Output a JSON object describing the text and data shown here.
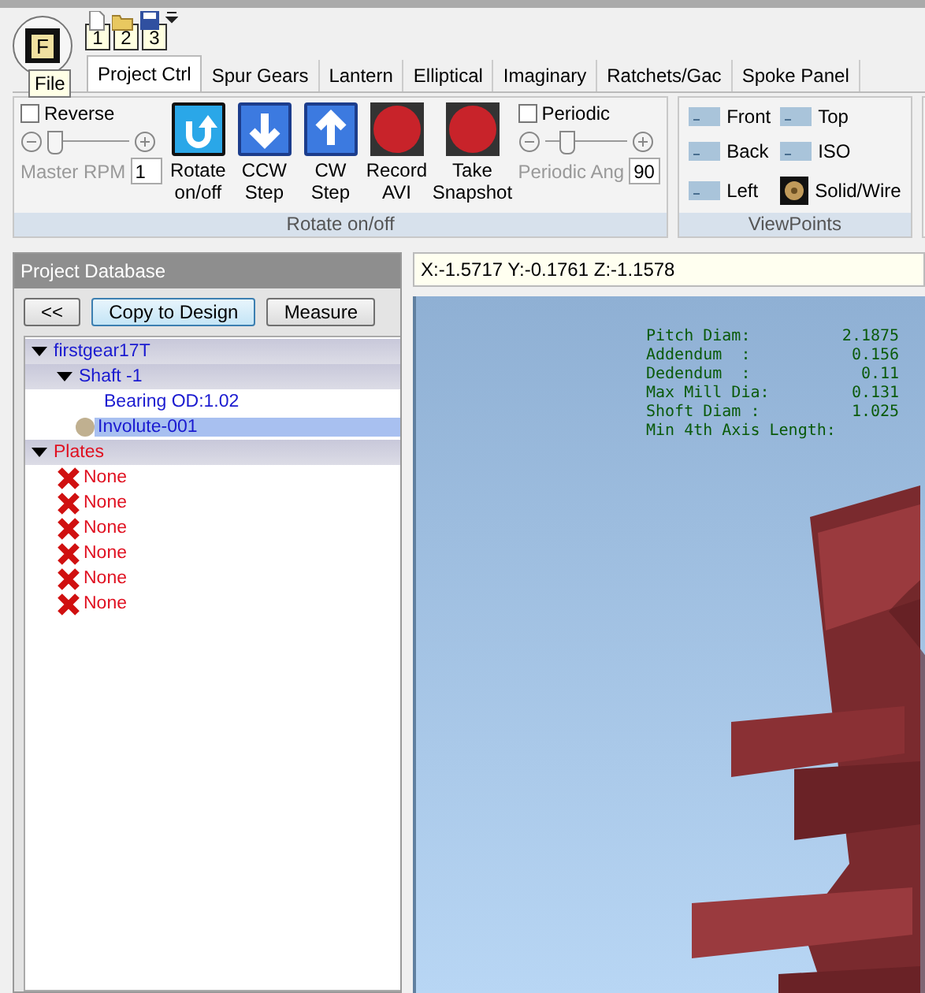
{
  "quick_access": {
    "app_button": "F",
    "tooltip": "File",
    "key_tips": [
      "1",
      "2",
      "3"
    ]
  },
  "tabs": [
    {
      "label": "Project Ctrl",
      "selected": true
    },
    {
      "label": "Spur Gears",
      "selected": false
    },
    {
      "label": "Lantern",
      "selected": false
    },
    {
      "label": "Elliptical",
      "selected": false
    },
    {
      "label": "Imaginary",
      "selected": false
    },
    {
      "label": "Ratchets/Gac",
      "selected": false
    },
    {
      "label": "Spoke Panel",
      "selected": false
    }
  ],
  "rotate_group": {
    "caption": "Rotate on/off",
    "reverse": {
      "label": "Reverse",
      "checked": false
    },
    "master": {
      "label": "Master RPM",
      "value": "1",
      "level": 0.08
    },
    "buttons": [
      {
        "label": "Rotate on/off",
        "kind": "rotate"
      },
      {
        "label": "CCW Step",
        "kind": "down"
      },
      {
        "label": "CW Step",
        "kind": "up"
      },
      {
        "label": "Record AVI",
        "kind": "record"
      },
      {
        "label": "Take Snapshot",
        "kind": "record"
      }
    ],
    "periodic": {
      "label": "Periodic",
      "checked": false
    },
    "periodic_angle": {
      "label": "Periodic Ang",
      "value": "90",
      "level": 0.25
    }
  },
  "viewpoints": {
    "caption": "ViewPoints",
    "items": [
      {
        "label": "Front",
        "kind": "view"
      },
      {
        "label": "Top",
        "kind": "view"
      },
      {
        "label": "Back",
        "kind": "view"
      },
      {
        "label": "ISO",
        "kind": "view"
      },
      {
        "label": "Left",
        "kind": "view"
      },
      {
        "label": "Solid/Wire",
        "kind": "solid"
      }
    ]
  },
  "database": {
    "title": "Project Database",
    "buttons": [
      {
        "label": "<<",
        "focused": false
      },
      {
        "label": "Copy to Design",
        "focused": true
      },
      {
        "label": "Measure",
        "focused": false
      }
    ],
    "tree": [
      {
        "label": "firstgear17T",
        "kind": "part",
        "expanded": true,
        "selected": false,
        "children": [
          {
            "label": "Shaft -1",
            "kind": "part",
            "expanded": true,
            "selected": false,
            "children": [
              {
                "label": "Bearing OD:1.02",
                "kind": "leaf",
                "selected": false
              },
              {
                "label": "Involute-001",
                "kind": "dot",
                "selected": true
              }
            ]
          }
        ]
      },
      {
        "label": "Plates",
        "kind": "error",
        "expanded": true,
        "selected": false,
        "children": [
          {
            "label": "None",
            "kind": "missing",
            "selected": false
          },
          {
            "label": "None",
            "kind": "missing",
            "selected": false
          },
          {
            "label": "None",
            "kind": "missing",
            "selected": false
          },
          {
            "label": "None",
            "kind": "missing",
            "selected": false
          },
          {
            "label": "None",
            "kind": "missing",
            "selected": false
          },
          {
            "label": "None",
            "kind": "missing",
            "selected": false
          }
        ]
      }
    ]
  },
  "viewport": {
    "coordinates": "X:-1.5717 Y:-0.1761 Z:-1.1578",
    "readouts": [
      {
        "label": "Pitch Diam:",
        "value": "2.1875"
      },
      {
        "label": "Addendum  :",
        "value": "0.156"
      },
      {
        "label": "Dedendum  :",
        "value": "0.11"
      },
      {
        "label": "Max Mill Dia:",
        "value": "0.131"
      },
      {
        "label": "Shoft Diam :",
        "value": "1.025"
      },
      {
        "label": "Min 4th Axis Length:"
      }
    ]
  }
}
